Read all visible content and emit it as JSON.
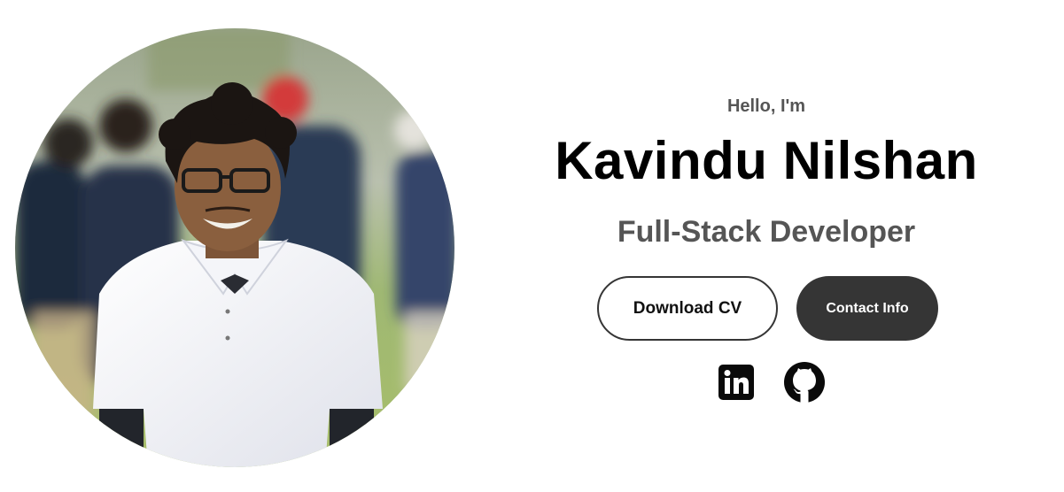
{
  "hero": {
    "greeting": "Hello, I'm",
    "name": "Kavindu Nilshan",
    "role": "Full-Stack Developer",
    "profile_photo": {
      "alt": "Kavindu Nilshan"
    },
    "buttons": {
      "download_cv": "Download CV",
      "contact_info": "Contact Info"
    },
    "socials": [
      {
        "icon": "linkedin-icon"
      },
      {
        "icon": "github-icon"
      }
    ]
  },
  "colors": {
    "text_primary": "#000000",
    "text_secondary": "#555555",
    "button_dark": "#353535",
    "background": "#ffffff"
  }
}
